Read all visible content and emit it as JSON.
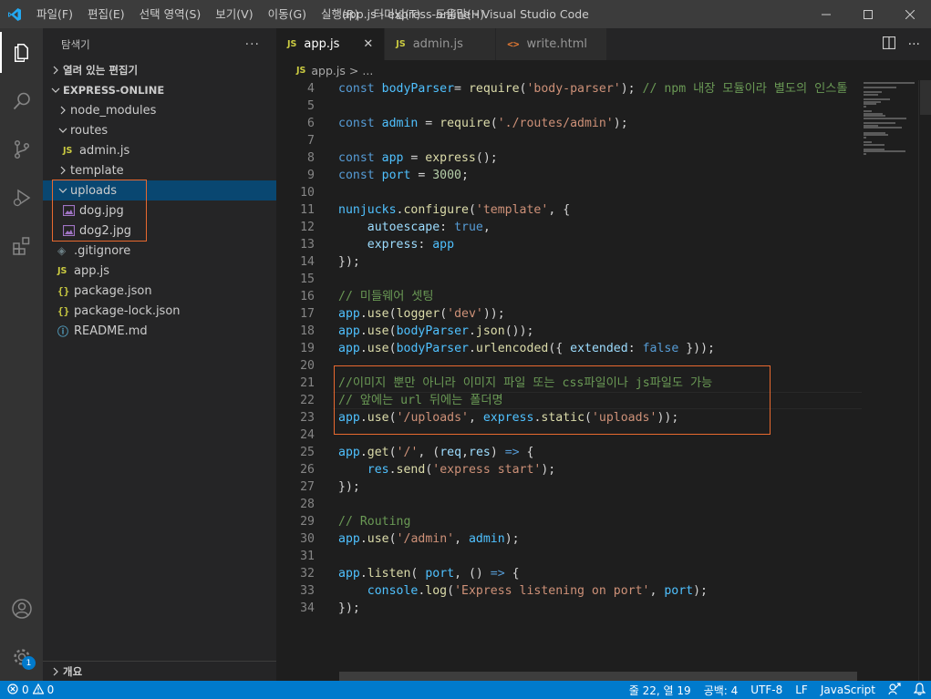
{
  "titlebar": {
    "menu": [
      "파일(F)",
      "편집(E)",
      "선택 영역(S)",
      "보기(V)",
      "이동(G)",
      "실행(R)",
      "터미널(T)",
      "도움말(H)"
    ],
    "title": "app.js - express-online - Visual Studio Code"
  },
  "activitybar": {
    "items": [
      "explorer-icon",
      "search-icon",
      "source-control-icon",
      "run-debug-icon",
      "extensions-icon"
    ],
    "bottom": [
      "account-icon",
      "manage-gear-icon"
    ],
    "manage_badge": "1"
  },
  "sidebar": {
    "title": "탐색기",
    "more": "···",
    "open_editors": "열려 있는 편집기",
    "project": "EXPRESS-ONLINE",
    "tree": [
      {
        "label": "node_modules",
        "kind": "folder",
        "expanded": false,
        "depth": 0
      },
      {
        "label": "routes",
        "kind": "folder",
        "expanded": true,
        "depth": 0
      },
      {
        "label": "admin.js",
        "kind": "js",
        "depth": 1
      },
      {
        "label": "template",
        "kind": "folder",
        "expanded": false,
        "depth": 0
      },
      {
        "label": "uploads",
        "kind": "folder",
        "expanded": true,
        "depth": 0,
        "selected": true
      },
      {
        "label": "dog.jpg",
        "kind": "image",
        "depth": 1
      },
      {
        "label": "dog2.jpg",
        "kind": "image",
        "depth": 1
      },
      {
        "label": ".gitignore",
        "kind": "git",
        "depth": 0
      },
      {
        "label": "app.js",
        "kind": "js",
        "depth": 0
      },
      {
        "label": "package.json",
        "kind": "json",
        "depth": 0
      },
      {
        "label": "package-lock.json",
        "kind": "json",
        "depth": 0
      },
      {
        "label": "README.md",
        "kind": "info",
        "depth": 0
      }
    ],
    "outline": "개요"
  },
  "tabs": [
    {
      "label": "app.js",
      "icon": "JS",
      "active": true,
      "close": "✕"
    },
    {
      "label": "admin.js",
      "icon": "JS",
      "active": false
    },
    {
      "label": "write.html",
      "icon": "<>",
      "active": false
    }
  ],
  "breadcrumb": {
    "file": "app.js",
    "sep": ">",
    "rest": "..."
  },
  "code": [
    {
      "n": "4",
      "tokens": [
        [
          "kw",
          "const "
        ],
        [
          "var",
          "bodyParser"
        ],
        [
          "",
          "="
        ],
        [
          "fn",
          " require"
        ],
        [
          "",
          "("
        ],
        [
          "str",
          "'body-parser'"
        ],
        [
          "",
          "); "
        ],
        [
          "cm",
          "// npm 내장 모듈이라 별도의 인스톨"
        ]
      ]
    },
    {
      "n": "5",
      "tokens": []
    },
    {
      "n": "6",
      "tokens": [
        [
          "kw",
          "const "
        ],
        [
          "var",
          "admin"
        ],
        [
          "",
          " = "
        ],
        [
          "fn",
          "require"
        ],
        [
          "",
          "("
        ],
        [
          "str",
          "'./routes/admin'"
        ],
        [
          "",
          ");"
        ]
      ]
    },
    {
      "n": "7",
      "tokens": []
    },
    {
      "n": "8",
      "tokens": [
        [
          "kw",
          "const "
        ],
        [
          "var",
          "app"
        ],
        [
          "",
          " = "
        ],
        [
          "fn",
          "express"
        ],
        [
          "",
          "();"
        ]
      ]
    },
    {
      "n": "9",
      "tokens": [
        [
          "kw",
          "const "
        ],
        [
          "var",
          "port"
        ],
        [
          "",
          " = "
        ],
        [
          "num",
          "3000"
        ],
        [
          "",
          ";"
        ]
      ]
    },
    {
      "n": "10",
      "tokens": []
    },
    {
      "n": "11",
      "tokens": [
        [
          "var",
          "nunjucks"
        ],
        [
          "",
          "."
        ],
        [
          "fn",
          "configure"
        ],
        [
          "",
          "("
        ],
        [
          "str",
          "'template'"
        ],
        [
          "",
          ", {"
        ]
      ]
    },
    {
      "n": "12",
      "tokens": [
        [
          "",
          "    "
        ],
        [
          "prop",
          "autoescape"
        ],
        [
          "",
          ": "
        ],
        [
          "kw",
          "true"
        ],
        [
          "",
          ","
        ]
      ]
    },
    {
      "n": "13",
      "tokens": [
        [
          "",
          "    "
        ],
        [
          "prop",
          "express"
        ],
        [
          "",
          ": "
        ],
        [
          "var",
          "app"
        ]
      ]
    },
    {
      "n": "14",
      "tokens": [
        [
          "",
          "});"
        ]
      ]
    },
    {
      "n": "15",
      "tokens": []
    },
    {
      "n": "16",
      "tokens": [
        [
          "cm",
          "// 미들웨어 셋팅"
        ]
      ]
    },
    {
      "n": "17",
      "tokens": [
        [
          "var",
          "app"
        ],
        [
          "",
          "."
        ],
        [
          "fn",
          "use"
        ],
        [
          "",
          "("
        ],
        [
          "fn",
          "logger"
        ],
        [
          "",
          "("
        ],
        [
          "str",
          "'dev'"
        ],
        [
          "",
          "));"
        ]
      ]
    },
    {
      "n": "18",
      "tokens": [
        [
          "var",
          "app"
        ],
        [
          "",
          "."
        ],
        [
          "fn",
          "use"
        ],
        [
          "",
          "("
        ],
        [
          "var",
          "bodyParser"
        ],
        [
          "",
          "."
        ],
        [
          "fn",
          "json"
        ],
        [
          "",
          "());"
        ]
      ]
    },
    {
      "n": "19",
      "tokens": [
        [
          "var",
          "app"
        ],
        [
          "",
          "."
        ],
        [
          "fn",
          "use"
        ],
        [
          "",
          "("
        ],
        [
          "var",
          "bodyParser"
        ],
        [
          "",
          "."
        ],
        [
          "fn",
          "urlencoded"
        ],
        [
          "",
          "({ "
        ],
        [
          "prop",
          "extended"
        ],
        [
          "",
          ": "
        ],
        [
          "kw",
          "false"
        ],
        [
          "",
          " }));"
        ]
      ]
    },
    {
      "n": "20",
      "tokens": []
    },
    {
      "n": "21",
      "tokens": [
        [
          "cm",
          "//이미지 뿐만 아니라 이미지 파일 또는 css파일이나 js파일도 가능"
        ]
      ]
    },
    {
      "n": "22",
      "tokens": [
        [
          "cm",
          "// 앞에는 url 뒤에는 폴더명"
        ]
      ]
    },
    {
      "n": "23",
      "tokens": [
        [
          "var",
          "app"
        ],
        [
          "",
          "."
        ],
        [
          "fn",
          "use"
        ],
        [
          "",
          "("
        ],
        [
          "str",
          "'/uploads'"
        ],
        [
          "",
          ", "
        ],
        [
          "var",
          "express"
        ],
        [
          "",
          "."
        ],
        [
          "fn",
          "static"
        ],
        [
          "",
          "("
        ],
        [
          "str",
          "'uploads'"
        ],
        [
          "",
          "));"
        ]
      ]
    },
    {
      "n": "24",
      "tokens": []
    },
    {
      "n": "25",
      "tokens": [
        [
          "var",
          "app"
        ],
        [
          "",
          "."
        ],
        [
          "fn",
          "get"
        ],
        [
          "",
          "("
        ],
        [
          "str",
          "'/'"
        ],
        [
          "",
          ", ("
        ],
        [
          "prop",
          "req"
        ],
        [
          "",
          ","
        ],
        [
          "prop",
          "res"
        ],
        [
          "",
          ") "
        ],
        [
          "kw",
          "=>"
        ],
        [
          "",
          " {"
        ]
      ]
    },
    {
      "n": "26",
      "tokens": [
        [
          "",
          "    "
        ],
        [
          "var",
          "res"
        ],
        [
          "",
          "."
        ],
        [
          "fn",
          "send"
        ],
        [
          "",
          "("
        ],
        [
          "str",
          "'express start'"
        ],
        [
          "",
          ");"
        ]
      ]
    },
    {
      "n": "27",
      "tokens": [
        [
          "",
          "});"
        ]
      ]
    },
    {
      "n": "28",
      "tokens": []
    },
    {
      "n": "29",
      "tokens": [
        [
          "cm",
          "// Routing"
        ]
      ]
    },
    {
      "n": "30",
      "tokens": [
        [
          "var",
          "app"
        ],
        [
          "",
          "."
        ],
        [
          "fn",
          "use"
        ],
        [
          "",
          "("
        ],
        [
          "str",
          "'/admin'"
        ],
        [
          "",
          ", "
        ],
        [
          "var",
          "admin"
        ],
        [
          "",
          ");"
        ]
      ]
    },
    {
      "n": "31",
      "tokens": []
    },
    {
      "n": "32",
      "tokens": [
        [
          "var",
          "app"
        ],
        [
          "",
          "."
        ],
        [
          "fn",
          "listen"
        ],
        [
          "",
          "( "
        ],
        [
          "var",
          "port"
        ],
        [
          "",
          ", () "
        ],
        [
          "kw",
          "=>"
        ],
        [
          "",
          " {"
        ]
      ]
    },
    {
      "n": "33",
      "tokens": [
        [
          "",
          "    "
        ],
        [
          "var",
          "console"
        ],
        [
          "",
          "."
        ],
        [
          "fn",
          "log"
        ],
        [
          "",
          "("
        ],
        [
          "str",
          "'Express listening on port'"
        ],
        [
          "",
          ", "
        ],
        [
          "var",
          "port"
        ],
        [
          "",
          ");"
        ]
      ]
    },
    {
      "n": "34",
      "tokens": [
        [
          "",
          "});"
        ]
      ]
    }
  ],
  "statusbar": {
    "errors": "0",
    "warnings": "0",
    "position": "줄 22, 열 19",
    "spaces": "공백: 4",
    "encoding": "UTF-8",
    "eol": "LF",
    "language": "JavaScript"
  },
  "colors": {
    "accent": "#007acc",
    "highlight_box": "#e8692f"
  }
}
